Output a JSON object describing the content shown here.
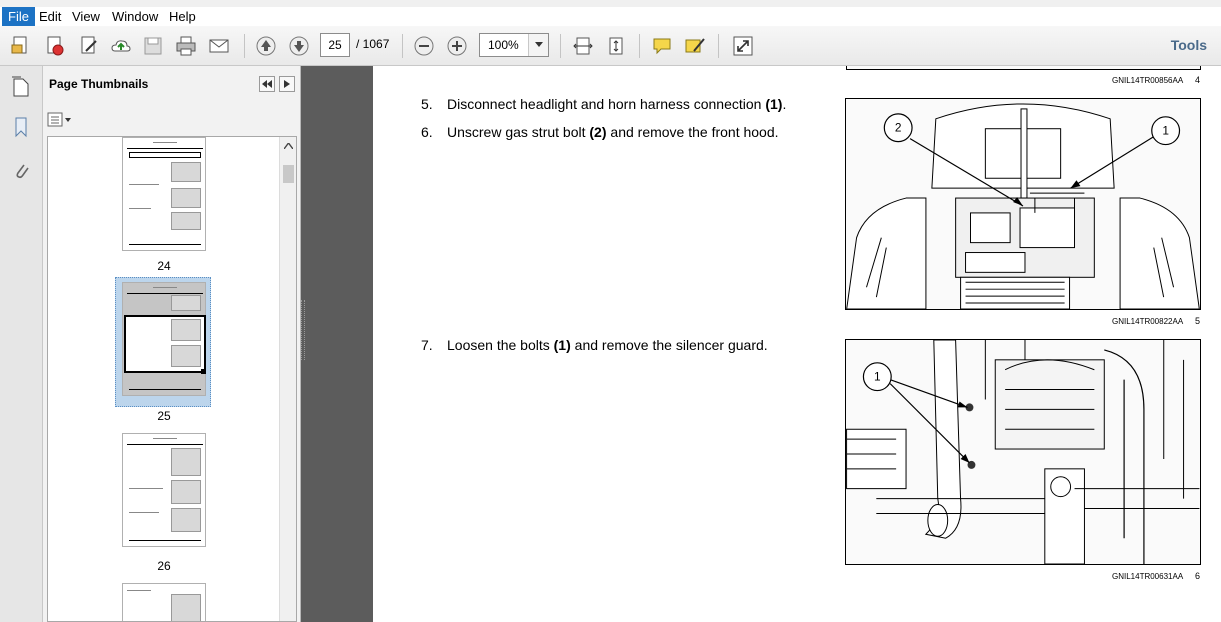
{
  "menu": {
    "file": "File",
    "edit": "Edit",
    "view": "View",
    "window": "Window",
    "help": "Help"
  },
  "toolbar": {
    "current_page": "25",
    "page_total": "/ 1067",
    "zoom": "100%",
    "tools": "Tools"
  },
  "panel": {
    "title": "Page Thumbnails",
    "thumbnails": [
      {
        "label": "24"
      },
      {
        "label": "25"
      },
      {
        "label": "26"
      }
    ]
  },
  "document": {
    "top_caption": {
      "code": "GNIL14TR00856AA",
      "num": "4"
    },
    "steps": [
      {
        "num": "5.",
        "text": "Disconnect headlight and horn harness connection ",
        "ref": "(1)",
        "tail": "."
      },
      {
        "num": "6.",
        "text": "Unscrew gas strut bolt ",
        "ref": "(2)",
        "tail": " and remove the front hood."
      },
      {
        "num": "7.",
        "text": "Loosen the bolts ",
        "ref": "(1)",
        "tail": " and remove the silencer guard."
      }
    ],
    "figures": [
      {
        "callouts": [
          "2",
          "1"
        ],
        "code": "GNIL14TR00822AA",
        "num": "5"
      },
      {
        "callouts": [
          "1"
        ],
        "code": "GNIL14TR00631AA",
        "num": "6"
      }
    ]
  },
  "colors": {
    "accent": "#1c72c4",
    "doc_bg": "#5c5c5c",
    "selection": "#bcd5ec"
  }
}
